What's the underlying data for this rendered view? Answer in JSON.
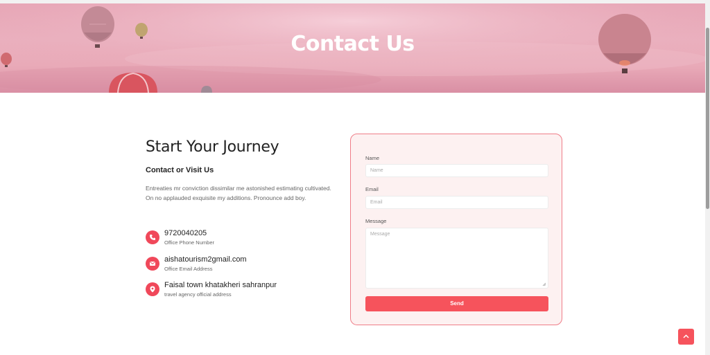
{
  "hero": {
    "title": "Contact Us"
  },
  "intro": {
    "heading": "Start Your Journey",
    "subheading": "Contact or Visit Us",
    "description": "Entreaties mr conviction dissimilar me astonished estimating cultivated. On no applauded exquisite my additions. Pronounce add boy."
  },
  "contacts": [
    {
      "icon": "phone-icon",
      "title": "9720040205",
      "subtitle": "Office Phone Number"
    },
    {
      "icon": "envelope-icon",
      "title": "aishatourism2gmail.com",
      "subtitle": "Office Email Address"
    },
    {
      "icon": "location-pin-icon",
      "title": "Faisal town khatakheri sahranpur",
      "subtitle": "travel agency official address"
    }
  ],
  "form": {
    "name_label": "Name",
    "name_placeholder": "Name",
    "email_label": "Email",
    "email_placeholder": "Email",
    "message_label": "Message",
    "message_placeholder": "Message",
    "send_label": "Send"
  },
  "colors": {
    "accent": "#f6535c",
    "hero": "#e7a6b6",
    "form_bg": "#fdf1f1"
  }
}
